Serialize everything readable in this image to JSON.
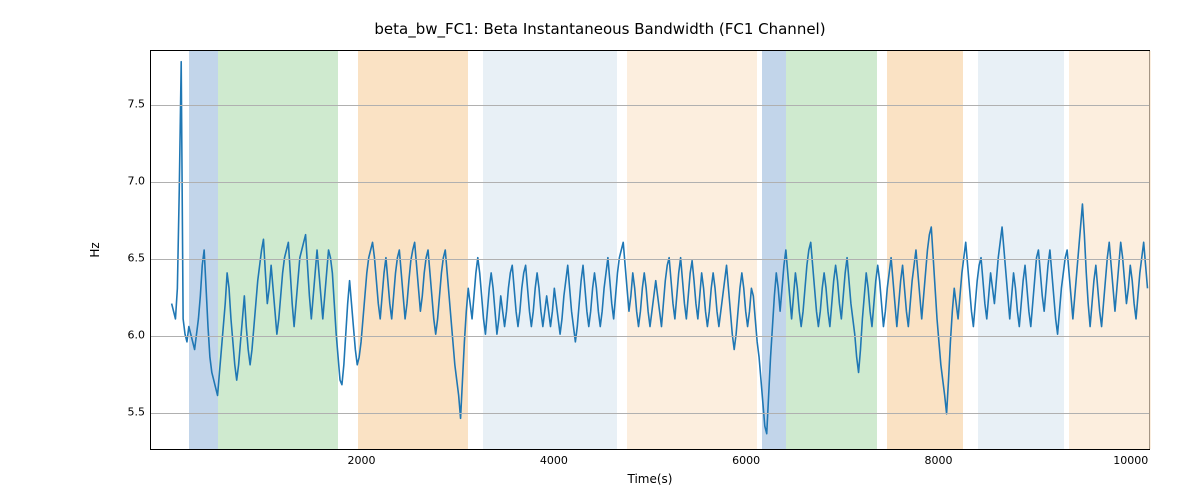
{
  "chart_data": {
    "type": "line",
    "title": "beta_bw_FC1: Beta Instantaneous Bandwidth (FC1 Channel)",
    "xlabel": "Time(s)",
    "ylabel": "Hz",
    "xlim": [
      -200,
      10200
    ],
    "ylim": [
      5.25,
      7.85
    ],
    "xticks": [
      2000,
      4000,
      6000,
      8000,
      10000
    ],
    "yticks": [
      5.5,
      6.0,
      6.5,
      7.0,
      7.5
    ],
    "grid": true,
    "regions": [
      {
        "x0": 200,
        "x1": 500,
        "color": "#8fb3d9",
        "alpha": 0.55
      },
      {
        "x0": 500,
        "x1": 1750,
        "color": "#a8d8a8",
        "alpha": 0.55
      },
      {
        "x0": 1950,
        "x1": 3100,
        "color": "#f7cf9c",
        "alpha": 0.6
      },
      {
        "x0": 3250,
        "x1": 4650,
        "color": "#d6e3ef",
        "alpha": 0.55
      },
      {
        "x0": 4750,
        "x1": 6100,
        "color": "#fbe5cc",
        "alpha": 0.65
      },
      {
        "x0": 6150,
        "x1": 6400,
        "color": "#8fb3d9",
        "alpha": 0.55
      },
      {
        "x0": 6400,
        "x1": 7350,
        "color": "#a8d8a8",
        "alpha": 0.55
      },
      {
        "x0": 7450,
        "x1": 8250,
        "color": "#f7cf9c",
        "alpha": 0.6
      },
      {
        "x0": 8400,
        "x1": 9300,
        "color": "#d6e3ef",
        "alpha": 0.55
      },
      {
        "x0": 9350,
        "x1": 10200,
        "color": "#fbe5cc",
        "alpha": 0.65
      }
    ],
    "series": [
      {
        "name": "beta_bw_FC1",
        "color": "#1f77b4",
        "x": [
          0,
          20,
          40,
          60,
          80,
          100,
          120,
          140,
          160,
          180,
          200,
          220,
          240,
          260,
          280,
          300,
          320,
          340,
          360,
          380,
          400,
          420,
          440,
          460,
          480,
          500,
          520,
          540,
          560,
          580,
          600,
          620,
          640,
          660,
          680,
          700,
          720,
          740,
          760,
          780,
          800,
          820,
          840,
          860,
          880,
          900,
          920,
          940,
          960,
          980,
          1000,
          1020,
          1040,
          1060,
          1080,
          1100,
          1120,
          1140,
          1160,
          1180,
          1200,
          1220,
          1240,
          1260,
          1280,
          1300,
          1320,
          1340,
          1360,
          1380,
          1400,
          1420,
          1440,
          1460,
          1480,
          1500,
          1520,
          1540,
          1560,
          1580,
          1600,
          1620,
          1640,
          1660,
          1680,
          1700,
          1720,
          1740,
          1760,
          1780,
          1800,
          1820,
          1840,
          1860,
          1880,
          1900,
          1920,
          1940,
          1960,
          1980,
          2000,
          2020,
          2040,
          2060,
          2080,
          2100,
          2120,
          2140,
          2160,
          2180,
          2200,
          2220,
          2240,
          2260,
          2280,
          2300,
          2320,
          2340,
          2360,
          2380,
          2400,
          2420,
          2440,
          2460,
          2480,
          2500,
          2520,
          2540,
          2560,
          2580,
          2600,
          2620,
          2640,
          2660,
          2680,
          2700,
          2720,
          2740,
          2760,
          2780,
          2800,
          2820,
          2840,
          2860,
          2880,
          2900,
          2920,
          2940,
          2960,
          2980,
          3000,
          3020,
          3040,
          3060,
          3080,
          3100,
          3120,
          3140,
          3160,
          3180,
          3200,
          3220,
          3240,
          3260,
          3280,
          3300,
          3320,
          3340,
          3360,
          3380,
          3400,
          3420,
          3440,
          3460,
          3480,
          3500,
          3520,
          3540,
          3560,
          3580,
          3600,
          3620,
          3640,
          3660,
          3680,
          3700,
          3720,
          3740,
          3760,
          3780,
          3800,
          3820,
          3840,
          3860,
          3880,
          3900,
          3920,
          3940,
          3960,
          3980,
          4000,
          4020,
          4040,
          4060,
          4080,
          4100,
          4120,
          4140,
          4160,
          4180,
          4200,
          4220,
          4240,
          4260,
          4280,
          4300,
          4320,
          4340,
          4360,
          4380,
          4400,
          4420,
          4440,
          4460,
          4480,
          4500,
          4520,
          4540,
          4560,
          4580,
          4600,
          4620,
          4640,
          4660,
          4680,
          4700,
          4720,
          4740,
          4760,
          4780,
          4800,
          4820,
          4840,
          4860,
          4880,
          4900,
          4920,
          4940,
          4960,
          4980,
          5000,
          5020,
          5040,
          5060,
          5080,
          5100,
          5120,
          5140,
          5160,
          5180,
          5200,
          5220,
          5240,
          5260,
          5280,
          5300,
          5320,
          5340,
          5360,
          5380,
          5400,
          5420,
          5440,
          5460,
          5480,
          5500,
          5520,
          5540,
          5560,
          5580,
          5600,
          5620,
          5640,
          5660,
          5680,
          5700,
          5720,
          5740,
          5760,
          5780,
          5800,
          5820,
          5840,
          5860,
          5880,
          5900,
          5920,
          5940,
          5960,
          5980,
          6000,
          6020,
          6040,
          6060,
          6080,
          6100,
          6120,
          6140,
          6160,
          6180,
          6200,
          6220,
          6240,
          6260,
          6280,
          6300,
          6320,
          6340,
          6360,
          6380,
          6400,
          6420,
          6440,
          6460,
          6480,
          6500,
          6520,
          6540,
          6560,
          6580,
          6600,
          6620,
          6640,
          6660,
          6680,
          6700,
          6720,
          6740,
          6760,
          6780,
          6800,
          6820,
          6840,
          6860,
          6880,
          6900,
          6920,
          6940,
          6960,
          6980,
          7000,
          7020,
          7040,
          7060,
          7080,
          7100,
          7120,
          7140,
          7160,
          7180,
          7200,
          7220,
          7240,
          7260,
          7280,
          7300,
          7320,
          7340,
          7360,
          7380,
          7400,
          7420,
          7440,
          7460,
          7480,
          7500,
          7520,
          7540,
          7560,
          7580,
          7600,
          7620,
          7640,
          7660,
          7680,
          7700,
          7720,
          7740,
          7760,
          7780,
          7800,
          7820,
          7840,
          7860,
          7880,
          7900,
          7920,
          7940,
          7960,
          7980,
          8000,
          8020,
          8040,
          8060,
          8080,
          8100,
          8120,
          8140,
          8160,
          8180,
          8200,
          8220,
          8240,
          8260,
          8280,
          8300,
          8320,
          8340,
          8360,
          8380,
          8400,
          8420,
          8440,
          8460,
          8480,
          8500,
          8520,
          8540,
          8560,
          8580,
          8600,
          8620,
          8640,
          8660,
          8680,
          8700,
          8720,
          8740,
          8760,
          8780,
          8800,
          8820,
          8840,
          8860,
          8880,
          8900,
          8920,
          8940,
          8960,
          8980,
          9000,
          9020,
          9040,
          9060,
          9080,
          9100,
          9120,
          9140,
          9160,
          9180,
          9200,
          9220,
          9240,
          9260,
          9280,
          9300,
          9320,
          9340,
          9360,
          9380,
          9400,
          9420,
          9440,
          9460,
          9480,
          9500,
          9520,
          9540,
          9560,
          9580,
          9600,
          9620,
          9640,
          9660,
          9680,
          9700,
          9720,
          9740,
          9760,
          9780,
          9800,
          9820,
          9840,
          9860,
          9880,
          9900,
          9920,
          9940,
          9960,
          9980,
          10000,
          10020,
          10040,
          10060,
          10080,
          10100,
          10120,
          10140,
          10160,
          10180,
          10200
        ],
        "y": [
          6.2,
          6.15,
          6.1,
          6.3,
          6.95,
          7.78,
          6.1,
          6.0,
          5.95,
          6.05,
          6.0,
          5.95,
          5.9,
          6.0,
          6.1,
          6.25,
          6.45,
          6.55,
          6.3,
          6.05,
          5.85,
          5.75,
          5.7,
          5.65,
          5.6,
          5.75,
          5.9,
          6.05,
          6.2,
          6.4,
          6.3,
          6.1,
          5.95,
          5.8,
          5.7,
          5.8,
          5.95,
          6.1,
          6.25,
          6.05,
          5.9,
          5.8,
          5.9,
          6.05,
          6.2,
          6.35,
          6.45,
          6.55,
          6.62,
          6.4,
          6.2,
          6.3,
          6.45,
          6.3,
          6.15,
          6.0,
          6.1,
          6.25,
          6.4,
          6.5,
          6.55,
          6.6,
          6.4,
          6.2,
          6.05,
          6.2,
          6.35,
          6.5,
          6.55,
          6.6,
          6.65,
          6.45,
          6.25,
          6.1,
          6.25,
          6.4,
          6.55,
          6.4,
          6.25,
          6.1,
          6.25,
          6.4,
          6.55,
          6.5,
          6.4,
          6.2,
          6.0,
          5.85,
          5.7,
          5.67,
          5.8,
          6.0,
          6.2,
          6.35,
          6.2,
          6.05,
          5.9,
          5.8,
          5.85,
          5.95,
          6.1,
          6.25,
          6.4,
          6.5,
          6.55,
          6.6,
          6.5,
          6.35,
          6.2,
          6.1,
          6.25,
          6.4,
          6.5,
          6.35,
          6.2,
          6.1,
          6.25,
          6.4,
          6.5,
          6.55,
          6.4,
          6.25,
          6.1,
          6.2,
          6.35,
          6.48,
          6.55,
          6.6,
          6.45,
          6.3,
          6.15,
          6.25,
          6.4,
          6.5,
          6.55,
          6.4,
          6.25,
          6.1,
          6.0,
          6.1,
          6.25,
          6.4,
          6.5,
          6.55,
          6.4,
          6.25,
          6.1,
          5.95,
          5.8,
          5.7,
          5.6,
          5.45,
          5.7,
          5.95,
          6.15,
          6.3,
          6.2,
          6.1,
          6.25,
          6.4,
          6.5,
          6.4,
          6.25,
          6.1,
          6.0,
          6.15,
          6.3,
          6.4,
          6.3,
          6.15,
          6.0,
          6.1,
          6.25,
          6.15,
          6.05,
          6.15,
          6.3,
          6.4,
          6.45,
          6.3,
          6.15,
          6.05,
          6.15,
          6.3,
          6.4,
          6.45,
          6.3,
          6.15,
          6.05,
          6.15,
          6.3,
          6.4,
          6.3,
          6.15,
          6.05,
          6.15,
          6.25,
          6.15,
          6.05,
          6.15,
          6.3,
          6.2,
          6.1,
          6.0,
          6.1,
          6.25,
          6.35,
          6.45,
          6.3,
          6.15,
          6.05,
          5.95,
          6.05,
          6.2,
          6.35,
          6.45,
          6.3,
          6.15,
          6.05,
          6.15,
          6.3,
          6.4,
          6.3,
          6.15,
          6.05,
          6.15,
          6.3,
          6.4,
          6.5,
          6.35,
          6.2,
          6.1,
          6.25,
          6.4,
          6.5,
          6.55,
          6.6,
          6.45,
          6.3,
          6.15,
          6.25,
          6.4,
          6.3,
          6.15,
          6.05,
          6.15,
          6.3,
          6.4,
          6.3,
          6.15,
          6.05,
          6.15,
          6.25,
          6.35,
          6.25,
          6.15,
          6.05,
          6.2,
          6.35,
          6.45,
          6.5,
          6.35,
          6.2,
          6.1,
          6.25,
          6.4,
          6.5,
          6.35,
          6.2,
          6.1,
          6.25,
          6.4,
          6.48,
          6.35,
          6.2,
          6.1,
          6.25,
          6.4,
          6.3,
          6.15,
          6.05,
          6.15,
          6.3,
          6.4,
          6.3,
          6.15,
          6.05,
          6.15,
          6.25,
          6.35,
          6.45,
          6.3,
          6.15,
          6.0,
          5.9,
          6.0,
          6.15,
          6.3,
          6.4,
          6.3,
          6.15,
          6.05,
          6.15,
          6.3,
          6.25,
          6.1,
          5.95,
          5.85,
          5.7,
          5.55,
          5.4,
          5.35,
          5.6,
          5.85,
          6.05,
          6.25,
          6.4,
          6.3,
          6.15,
          6.3,
          6.45,
          6.55,
          6.4,
          6.25,
          6.1,
          6.25,
          6.4,
          6.3,
          6.15,
          6.05,
          6.15,
          6.3,
          6.45,
          6.55,
          6.6,
          6.45,
          6.3,
          6.15,
          6.05,
          6.15,
          6.3,
          6.4,
          6.3,
          6.15,
          6.05,
          6.2,
          6.35,
          6.45,
          6.35,
          6.2,
          6.1,
          6.25,
          6.4,
          6.5,
          6.35,
          6.2,
          6.1,
          6.0,
          5.85,
          5.75,
          5.9,
          6.1,
          6.25,
          6.4,
          6.3,
          6.15,
          6.05,
          6.2,
          6.35,
          6.45,
          6.35,
          6.2,
          6.05,
          6.15,
          6.3,
          6.4,
          6.5,
          6.35,
          6.2,
          6.05,
          6.2,
          6.35,
          6.45,
          6.3,
          6.15,
          6.05,
          6.2,
          6.35,
          6.45,
          6.55,
          6.4,
          6.25,
          6.1,
          6.25,
          6.4,
          6.55,
          6.65,
          6.7,
          6.5,
          6.3,
          6.1,
          5.95,
          5.8,
          5.7,
          5.6,
          5.48,
          5.7,
          5.95,
          6.15,
          6.3,
          6.2,
          6.1,
          6.25,
          6.4,
          6.5,
          6.6,
          6.45,
          6.3,
          6.15,
          6.05,
          6.2,
          6.35,
          6.45,
          6.5,
          6.35,
          6.2,
          6.1,
          6.25,
          6.4,
          6.3,
          6.2,
          6.35,
          6.5,
          6.6,
          6.7,
          6.55,
          6.4,
          6.25,
          6.1,
          6.25,
          6.4,
          6.3,
          6.15,
          6.05,
          6.2,
          6.35,
          6.45,
          6.3,
          6.15,
          6.05,
          6.2,
          6.35,
          6.5,
          6.55,
          6.4,
          6.25,
          6.15,
          6.3,
          6.45,
          6.55,
          6.4,
          6.25,
          6.1,
          6.0,
          6.15,
          6.3,
          6.4,
          6.5,
          6.55,
          6.4,
          6.25,
          6.1,
          6.25,
          6.4,
          6.55,
          6.7,
          6.85,
          6.65,
          6.4,
          6.2,
          6.05,
          6.2,
          6.35,
          6.45,
          6.3,
          6.15,
          6.05,
          6.2,
          6.35,
          6.5,
          6.6,
          6.45,
          6.3,
          6.15,
          6.3,
          6.45,
          6.6,
          6.5,
          6.35,
          6.2,
          6.3,
          6.45,
          6.35,
          6.2,
          6.1,
          6.25,
          6.4,
          6.5,
          6.6,
          6.45,
          6.3,
          6.15,
          6.3,
          6.45,
          6.35,
          6.2,
          6.1,
          6.25,
          6.4,
          6.5,
          6.6,
          6.45,
          6.3,
          6.15
        ]
      }
    ]
  }
}
